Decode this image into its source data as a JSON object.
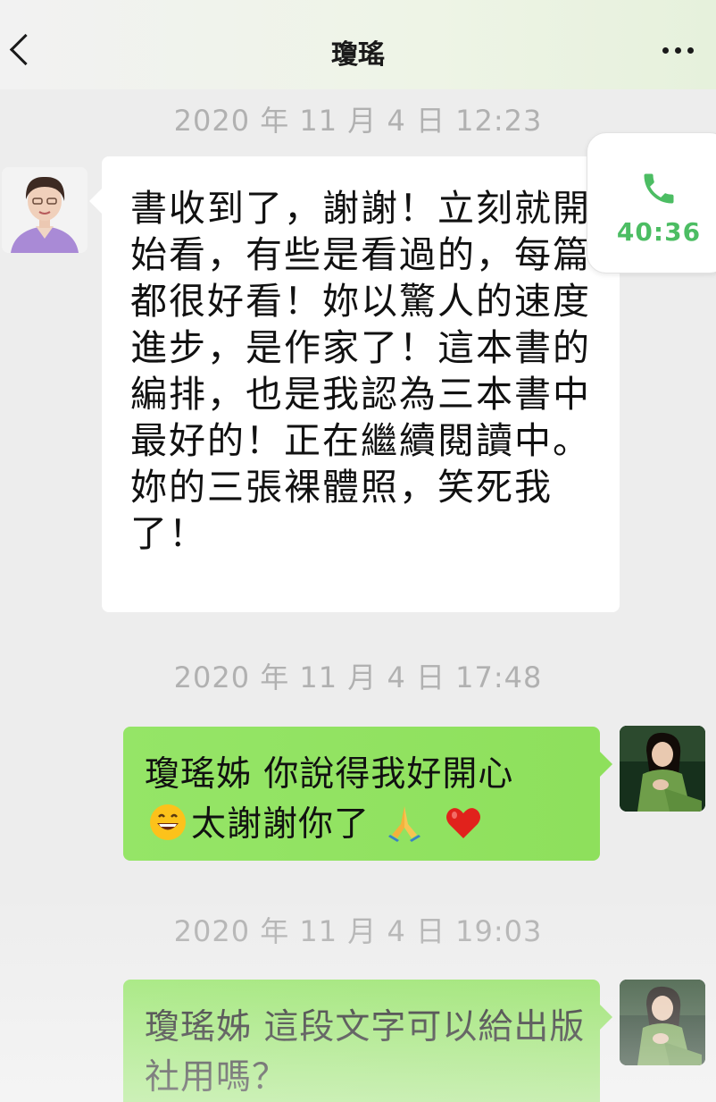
{
  "header": {
    "title": "瓊瑤",
    "back_icon": "chevron-left-icon",
    "more_icon": "more-dots-icon"
  },
  "call_card": {
    "icon": "phone-icon",
    "duration": "40:36",
    "color": "#4cbd63"
  },
  "messages": [
    {
      "timestamp": "2020 年 11 月 4 日 12:23",
      "sender": "other",
      "text": "書收到了，謝謝！立刻就開始看，有些是看過的，每篇都很好看！妳以驚人的速度進步，是作家了！這本書的編排，也是我認為三本書中最好的！正在繼續閱讀中。妳的三張裸體照，笑死我了！"
    },
    {
      "timestamp": "2020 年 11 月 4 日 17:48",
      "sender": "me",
      "text_line1": "瓊瑤姊 你說得我好開心",
      "text_line2": "太謝謝你了",
      "emojis": [
        "grinning-face-icon",
        "folded-hands-icon",
        "red-heart-icon"
      ]
    },
    {
      "timestamp": "2020 年 11 月 4 日 19:03",
      "sender": "me",
      "text": "瓊瑤姊 這段文字可以給出版社用嗎？"
    }
  ],
  "colors": {
    "background": "#ededed",
    "incoming_bubble": "#ffffff",
    "outgoing_bubble": "#8ee05c",
    "timestamp": "#b1b1b1"
  }
}
